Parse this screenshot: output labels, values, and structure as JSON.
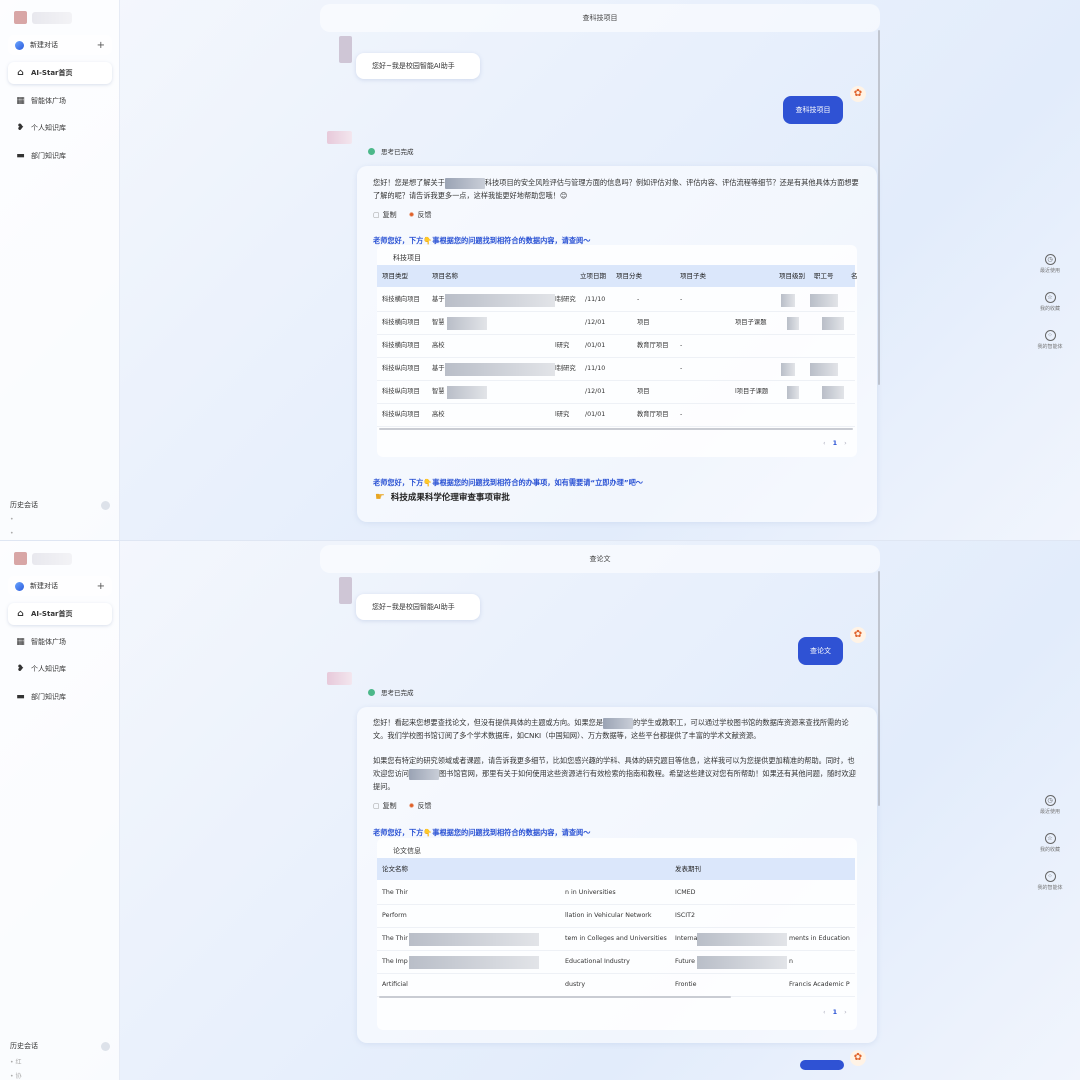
{
  "sidebar": {
    "new_chat": "新建对话",
    "items": [
      {
        "label": "AI-Star首页",
        "icon": "home-icon"
      },
      {
        "label": "智能体广场",
        "icon": "grid-icon"
      },
      {
        "label": "个人知识库",
        "icon": "bulb-heart-icon"
      },
      {
        "label": "部门知识库",
        "icon": "folder-icon"
      }
    ],
    "history_label": "历史会话",
    "history_items_bottom": [
      "红",
      "协"
    ]
  },
  "right_rail": [
    {
      "label": "最近使用",
      "icon": "clock-icon"
    },
    {
      "label": "我的收藏",
      "icon": "star-icon"
    },
    {
      "label": "我的智能体",
      "icon": "apps-icon"
    }
  ],
  "panel1": {
    "title": "查科技项目",
    "greeting": "您好~我是校园智能AI助手",
    "user_message": "查科技项目",
    "think": "思考已完成",
    "answer_pre": "您好！您是想了解关于",
    "answer_post": "科技项目的安全风险评估与管理方面的信息吗？例如评估对象、评估内容、评估流程等细节？还是有其他具体方面想要了解的呢？请告诉我更多一点，这样我能更好地帮助您哦！😊",
    "copy": "复制",
    "feedback": "反馈",
    "hint": "老师您好，下方👇事根据您的问题找到相符合的数据内容，请查阅～",
    "table_title": "科技项目",
    "columns": [
      "项目类型",
      "项目名称",
      "立项日期",
      "项目分类",
      "项目子类",
      "项目级别",
      "职工号",
      "名"
    ],
    "rows": [
      {
        "type": "科技横向项目",
        "name_a": "基于",
        "name_b": "l制研究",
        "date": "/11/10",
        "cat": "-",
        "sub": "-"
      },
      {
        "type": "科技横向项目",
        "name_a": "智慧",
        "name_b": "",
        "date": "/12/01",
        "cat": "项目",
        "sub": "项目子课题"
      },
      {
        "type": "科技横向项目",
        "name_a": "高校",
        "name_b": "l研究",
        "date": "/01/01",
        "cat": "教育厅项目",
        "sub": "-"
      },
      {
        "type": "科技纵向项目",
        "name_a": "基于",
        "name_b": "l制研究",
        "date": "/11/10",
        "cat": "",
        "sub": "-"
      },
      {
        "type": "科技纵向项目",
        "name_a": "智慧",
        "name_b": "",
        "date": "/12/01",
        "cat": "项目",
        "sub": "l项目子课题"
      },
      {
        "type": "科技纵向项目",
        "name_a": "高校",
        "name_b": "l研究",
        "date": "/01/01",
        "cat": "教育厅项目",
        "sub": "-"
      }
    ],
    "page": "1",
    "todo_hint": "老师您好，下方👇事根据您的问题找到相符合的办事项，如有需要请“立即办理”吧～",
    "todo_item": "科技成果科学伦理审查事项审批"
  },
  "panel2": {
    "title": "查论文",
    "greeting": "您好~我是校园智能AI助手",
    "user_message": "查论文",
    "think": "思考已完成",
    "answer1_pre": "您好！看起来您想要查找论文，但没有提供具体的主题或方向。如果您是",
    "answer1_post": "的学生或教职工，可以通过学校图书馆的数据库资源来查找所需的论文。我们学校图书馆订阅了多个学术数据库，如CNKI（中国知网）、万方数据等，这些平台都提供了丰富的学术文献资源。",
    "answer2_pre": "如果您有特定的研究领域或者课题，请告诉我更多细节，比如您感兴趣的学科、具体的研究题目等信息，这样我可以为您提供更加精准的帮助。同时，也欢迎您访问",
    "answer2_post": "图书馆官网，那里有关于如何使用这些资源进行有效检索的指南和教程。希望这些建议对您有所帮助！如果还有其他问题，随时欢迎提问。",
    "copy": "复制",
    "feedback": "反馈",
    "hint": "老师您好，下方👇事根据您的问题找到相符合的数据内容，请查阅～",
    "table_title": "论文信息",
    "columns": [
      "论文名称",
      "发表期刊"
    ],
    "rows": [
      {
        "a": "The Thir",
        "b": "n in Universities",
        "c": "ICMED",
        "d": ""
      },
      {
        "a": "Perform",
        "b": "llation in Vehicular Network",
        "c": "ISCIT2",
        "d": ""
      },
      {
        "a": "The Thir",
        "b": "tem in Colleges and Universities",
        "c": "Interna",
        "d": "ments in Education"
      },
      {
        "a": "The Imp",
        "b": "Educational Industry",
        "c": "Future",
        "d": "n"
      },
      {
        "a": "Artificial",
        "b": "dustry",
        "c": "Frontie",
        "d": "Francis Academic P"
      }
    ],
    "page": "1"
  }
}
